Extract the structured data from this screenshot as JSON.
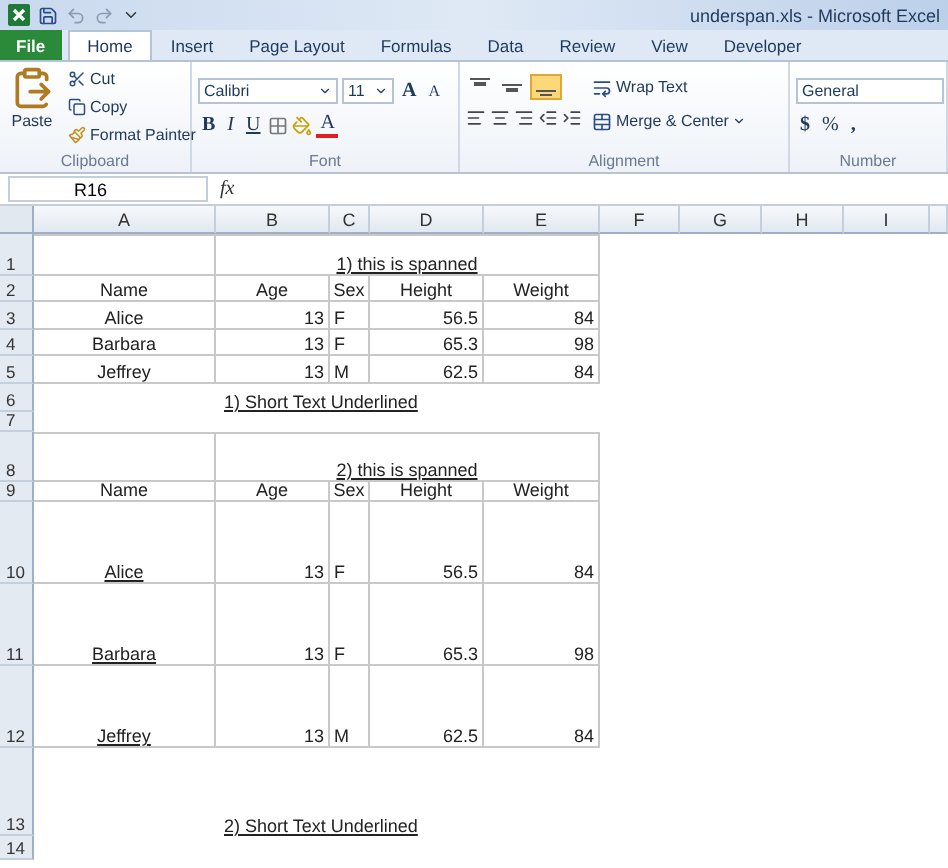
{
  "window": {
    "title": "underspan.xls - Microsoft Excel"
  },
  "tabs": [
    {
      "label": "File",
      "kind": "file",
      "selected": false
    },
    {
      "label": "Home",
      "kind": "tab",
      "selected": true
    },
    {
      "label": "Insert",
      "kind": "tab",
      "selected": false
    },
    {
      "label": "Page Layout",
      "kind": "tab",
      "selected": false
    },
    {
      "label": "Formulas",
      "kind": "tab",
      "selected": false
    },
    {
      "label": "Data",
      "kind": "tab",
      "selected": false
    },
    {
      "label": "Review",
      "kind": "tab",
      "selected": false
    },
    {
      "label": "View",
      "kind": "tab",
      "selected": false
    },
    {
      "label": "Developer",
      "kind": "tab",
      "selected": false
    }
  ],
  "clipboard": {
    "paste": "Paste",
    "cut": "Cut",
    "copy": "Copy",
    "format_painter": "Format Painter",
    "label": "Clipboard"
  },
  "font": {
    "family": "Calibri",
    "size": "11",
    "grow": "A",
    "shrink": "A",
    "bold": "B",
    "italic": "I",
    "underline": "U",
    "font_color": "A",
    "label": "Font"
  },
  "alignment": {
    "vertical": [
      {
        "selected": false
      },
      {
        "selected": false
      },
      {
        "selected": true
      }
    ],
    "wrap_text": "Wrap Text",
    "merge": "Merge & Center",
    "label": "Alignment"
  },
  "number": {
    "format": "General",
    "currency": "$",
    "percent": "%",
    "comma": ",",
    "label": "Number"
  },
  "formula_bar": {
    "name_box": "R16",
    "function_symbol": "fx"
  },
  "sheet": {
    "columns": [
      "A",
      "B",
      "C",
      "D",
      "E",
      "F",
      "G",
      "H",
      "I"
    ],
    "rows": [
      {
        "number": "1",
        "kind": "title",
        "text": "1) this is spanned",
        "underline": true
      },
      {
        "number": "2",
        "kind": "header",
        "cells": [
          "Name",
          "Age",
          "Sex",
          "Height",
          "Weight"
        ]
      },
      {
        "number": "3",
        "kind": "data",
        "underline": false,
        "cells": [
          "Alice",
          "13",
          "F",
          "56.5",
          "84"
        ]
      },
      {
        "number": "4",
        "kind": "data",
        "underline": false,
        "cells": [
          "Barbara",
          "13",
          "F",
          "65.3",
          "98"
        ]
      },
      {
        "number": "5",
        "kind": "data",
        "underline": false,
        "cells": [
          "Jeffrey",
          "13",
          "M",
          "62.5",
          "84"
        ]
      },
      {
        "number": "6",
        "kind": "note",
        "text": "1) Short Text Underlined",
        "underline": true
      },
      {
        "number": "7",
        "kind": "blank"
      },
      {
        "number": "8",
        "kind": "title",
        "text": "2) this is spanned",
        "underline": true
      },
      {
        "number": "9",
        "kind": "header",
        "cells": [
          "Name",
          "Age",
          "Sex",
          "Height",
          "Weight"
        ]
      },
      {
        "number": "10",
        "kind": "data",
        "underline": true,
        "cells": [
          "Alice",
          "13",
          "F",
          "56.5",
          "84"
        ]
      },
      {
        "number": "11",
        "kind": "data",
        "underline": true,
        "cells": [
          "Barbara",
          "13",
          "F",
          "65.3",
          "98"
        ]
      },
      {
        "number": "12",
        "kind": "data",
        "underline": true,
        "cells": [
          "Jeffrey",
          "13",
          "M",
          "62.5",
          "84"
        ]
      },
      {
        "number": "13",
        "kind": "note",
        "text": "2) Short Text Underlined",
        "underline": true
      },
      {
        "number": "14",
        "kind": "blank"
      }
    ]
  }
}
